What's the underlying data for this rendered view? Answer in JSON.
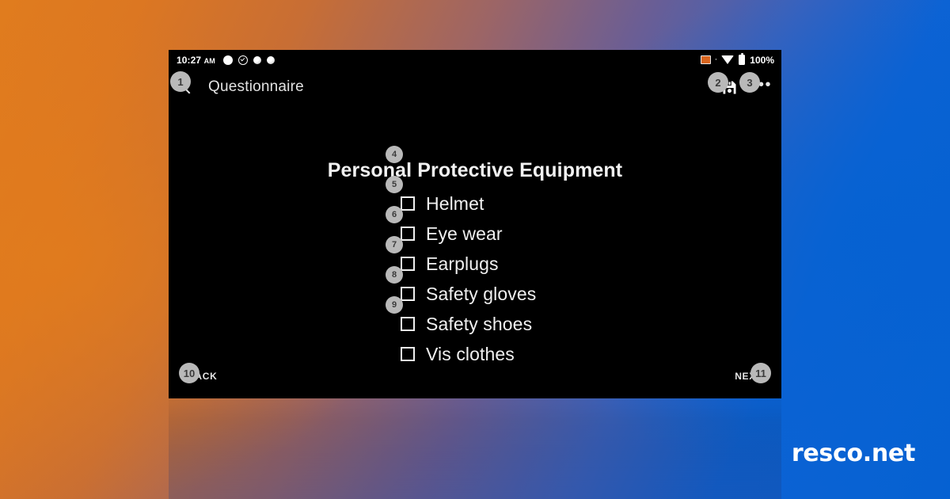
{
  "background": {
    "gradient_from": "#E07C1E",
    "gradient_mid": "#6B5E94",
    "gradient_to": "#0561D2"
  },
  "brand": {
    "logo_text": "resco.net",
    "logo_color": "#FFFFFF"
  },
  "device": {
    "status_bar": {
      "clock": "10:27",
      "clock_ampm": "AM",
      "battery_percent": "100%",
      "icons": [
        "notification-circle-icon",
        "notification-check-circle-icon",
        "notification-dot-icon",
        "notification-globe-icon"
      ],
      "right_icons": [
        "signal-icon",
        "wifi-icon",
        "battery-icon"
      ]
    },
    "app_bar": {
      "back_icon": "back-chevron-icon",
      "title": "Questionnaire",
      "save_icon": "save-floppy-icon",
      "overflow_icon": "overflow-menu-icon",
      "overflow_glyph": "•••"
    },
    "question": {
      "title": "Personal Protective Equipment",
      "options": [
        {
          "label": "Helmet",
          "checked": false
        },
        {
          "label": "Eye wear",
          "checked": false
        },
        {
          "label": "Earplugs",
          "checked": false
        },
        {
          "label": "Safety gloves",
          "checked": false
        },
        {
          "label": "Safety shoes",
          "checked": false
        },
        {
          "label": "Vis clothes",
          "checked": false
        }
      ]
    },
    "bottom_nav": {
      "back_label": "BACK",
      "next_label": "NEXT"
    }
  },
  "annotations": {
    "badge_bg": "#B9B9B9",
    "badge_fg": "#3B3B3B",
    "items": [
      {
        "n": "1",
        "target": "back-arrow"
      },
      {
        "n": "2",
        "target": "save-icon"
      },
      {
        "n": "3",
        "target": "overflow-menu"
      },
      {
        "n": "4",
        "target": "option-helmet"
      },
      {
        "n": "5",
        "target": "option-eye-wear"
      },
      {
        "n": "6",
        "target": "option-earplugs"
      },
      {
        "n": "7",
        "target": "option-safety-gloves"
      },
      {
        "n": "8",
        "target": "option-safety-shoes"
      },
      {
        "n": "9",
        "target": "option-vis-clothes"
      },
      {
        "n": "10",
        "target": "back-button"
      },
      {
        "n": "11",
        "target": "next-button"
      }
    ]
  }
}
